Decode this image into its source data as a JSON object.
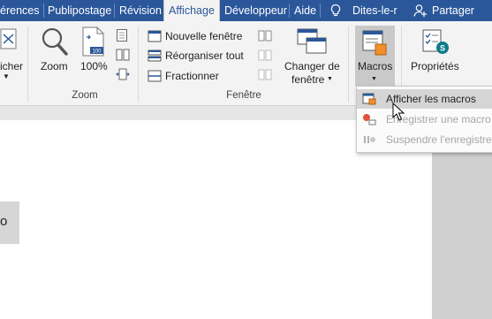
{
  "tabs": [
    {
      "label": "érences"
    },
    {
      "label": "Publipostage"
    },
    {
      "label": "Révision"
    },
    {
      "label": "Affichage",
      "active": true
    },
    {
      "label": "Développeur"
    },
    {
      "label": "Aide"
    },
    {
      "label": "Dites-le-r"
    },
    {
      "label": "Partager"
    }
  ],
  "ribbon": {
    "cut_label": "icher",
    "zoom_group": {
      "label": "Zoom",
      "zoom_button": "Zoom",
      "percent_button": "100%"
    },
    "window_group": {
      "label": "Fenêtre",
      "new_window": "Nouvelle fenêtre",
      "arrange_all": "Réorganiser tout",
      "split": "Fractionner",
      "switch_window_line1": "Changer de",
      "switch_window_line2": "fenêtre"
    },
    "macros_button": "Macros",
    "properties_button": "Propriétés"
  },
  "menu": {
    "items": [
      {
        "label": "Afficher les macros",
        "state": "hover"
      },
      {
        "label": "Enregistrer une macro...",
        "state": "disabled"
      },
      {
        "label": "Suspendre l'enregistrement",
        "state": "disabled"
      }
    ]
  },
  "document": {
    "box_text": "o"
  },
  "colors": {
    "ribbon_blue": "#2b579a",
    "ribbon_bg": "#f3f3f3",
    "record_red": "#e2513a",
    "menu_hover": "#d5d5d5"
  }
}
